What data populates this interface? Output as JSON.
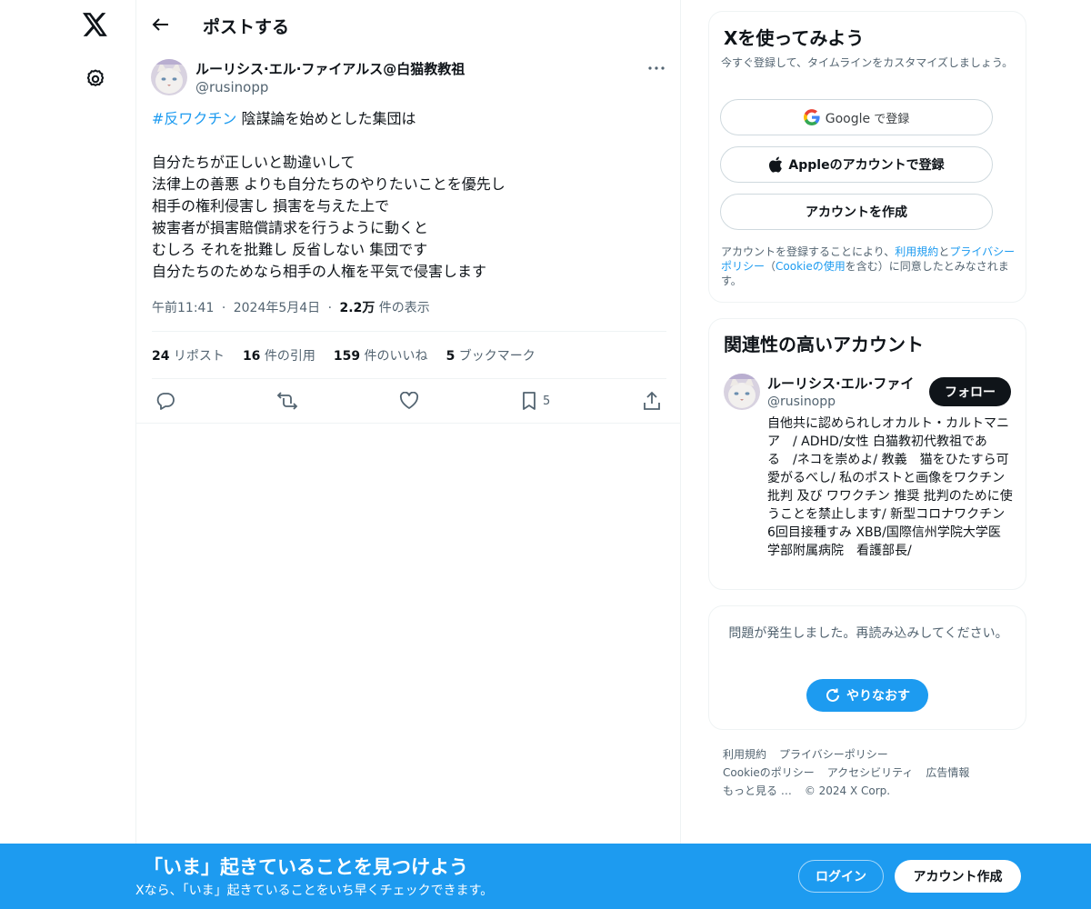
{
  "nav": {
    "logo_icon": "x-logo-icon",
    "settings_icon": "gear-icon"
  },
  "header": {
    "title": "ポストする",
    "back_icon": "back-arrow-icon"
  },
  "post": {
    "author_name": "ルーリシス·エル·ファイアルス@白猫教教祖",
    "author_handle": "@rusinopp",
    "hashtag": "#反ワクチン",
    "first_line_rest": " 陰謀論を始めとした集団は",
    "lines": [
      "自分たちが正しいと勘違いして",
      "法律上の善悪 よりも自分たちのやりたいことを優先し",
      "相手の権利侵害し 損害を与えた上で",
      "被害者が損害賠償請求を行うように動くと",
      "むしろ それを批難し 反省しない 集団です",
      "自分たちのためなら相手の人権を平気で侵害します"
    ],
    "time": "午前11:41",
    "date": "2024年5月4日",
    "separator": "·",
    "views_value": "2.2万",
    "views_label": " 件の表示",
    "stats": {
      "reposts_value": "24",
      "reposts_label": " リポスト",
      "quotes_value": "16",
      "quotes_label": " 件の引用",
      "likes_value": "159",
      "likes_label": " 件のいいね",
      "bookmarks_value": "5",
      "bookmarks_label": " ブックマーク"
    },
    "bookmark_count": "5"
  },
  "signup": {
    "title": "Xを使ってみよう",
    "subtitle": "今すぐ登録して、タイムラインをカスタマイズしましょう。",
    "google_brand": "Google",
    "google_label": " で登録",
    "apple_label": "Appleのアカウントで登録",
    "create_label": "アカウントを作成",
    "legal_1": "アカウントを登録することにより、",
    "legal_terms": "利用規約",
    "legal_and": "と",
    "legal_privacy": "プライバシーポリシー",
    "legal_paren_open": "（",
    "legal_cookie": "Cookieの使用",
    "legal_2": "を含む）に同意したとみなされます。"
  },
  "related": {
    "title": "関連性の高いアカウント",
    "name": "ルーリシス·エル·ファイ",
    "handle": "@rusinopp",
    "follow_label": "フォロー",
    "bio": "自他共に認められしオカルト・カルトマニア　/ ADHD/女性 白猫教初代教祖である　/ネコを崇めよ/ 教義　猫をひたすら可愛がるべし/ 私のポストと画像をワクチン 批判 及び ワワクチン 推奨 批判のために使うことを禁止します/ 新型コロナワクチン6回目接種すみ XBB/国際信州学院大学医学部附属病院　看護部長/"
  },
  "error_card": {
    "message": "問題が発生しました。再読み込みしてください。",
    "retry_label": "やりなおす"
  },
  "footer": {
    "terms": "利用規約",
    "privacy": "プライバシーポリシー",
    "cookie": "Cookieのポリシー",
    "accessibility": "アクセシビリティ",
    "ads": "広告情報",
    "more": "もっと見る …",
    "copyright": "© 2024 X Corp."
  },
  "banner": {
    "title": "「いま」起きていることを見つけよう",
    "subtitle": "Xなら、「いま」起きていることをいち早くチェックできます。",
    "login_label": "ログイン",
    "create_label": "アカウント作成"
  },
  "colors": {
    "accent": "#1d9bf0",
    "text": "#0f1419",
    "secondary": "#536471",
    "border": "#eff3f4"
  }
}
